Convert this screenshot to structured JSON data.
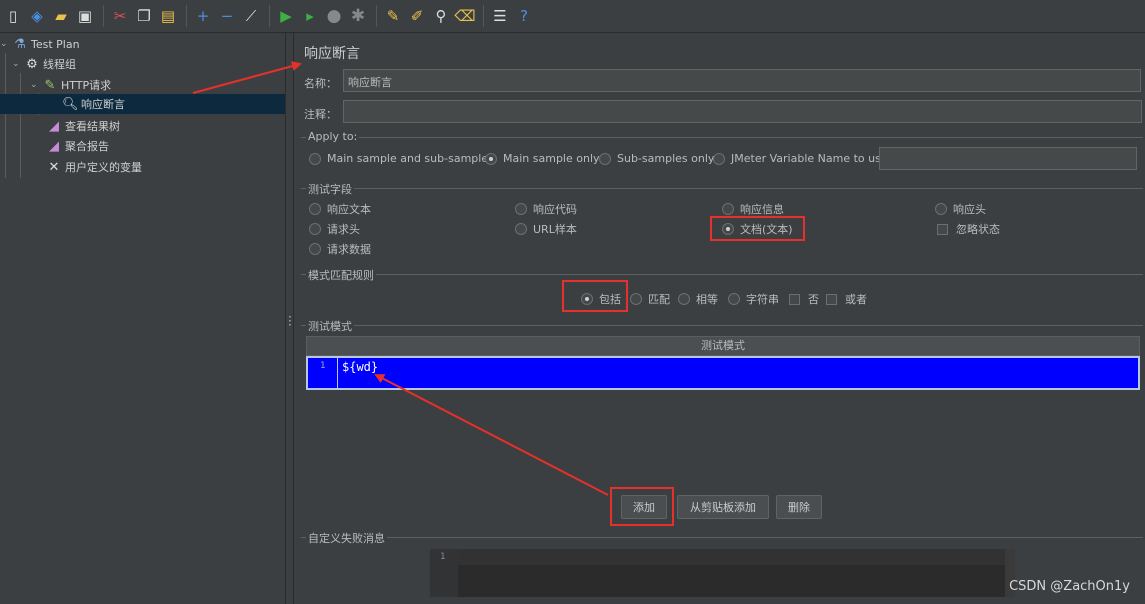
{
  "colors": {
    "accent_red": "#e5312a",
    "selection_blue": "#0000fe",
    "tree_selected": "#0d293e",
    "background": "#3c3f41"
  },
  "toolbar": {
    "icons": [
      "new-icon",
      "templates-icon",
      "open-icon",
      "save-icon",
      "cut-icon",
      "copy-icon",
      "paste-icon",
      "expand-icon",
      "collapse-icon",
      "toggle-icon",
      "start-icon",
      "start-no-pause-icon",
      "stop-icon",
      "shutdown-icon",
      "clear-icon",
      "clear-all-icon",
      "search-icon",
      "reset-search-icon",
      "function-helper-icon",
      "help-icon"
    ]
  },
  "tree": {
    "items": [
      {
        "label": "Test Plan",
        "icon": "flask-icon"
      },
      {
        "label": "线程组",
        "icon": "gear-icon"
      },
      {
        "label": "HTTP请求",
        "icon": "pipette-icon"
      },
      {
        "label": "响应断言",
        "icon": "assertion-icon"
      },
      {
        "label": "查看结果树",
        "icon": "chart-icon"
      },
      {
        "label": "聚合报告",
        "icon": "chart-icon"
      },
      {
        "label": "用户定义的变量",
        "icon": "tools-icon"
      }
    ]
  },
  "main": {
    "title": "响应断言",
    "name_label": "名称：",
    "name_value": "响应断言",
    "comment_label": "注释：",
    "comment_value": "",
    "apply_to": {
      "legend": "Apply to:",
      "options": [
        "Main sample and sub-samples",
        "Main sample only",
        "Sub-samples only",
        "JMeter Variable Name to use"
      ],
      "selected": "Main sample only",
      "variable_value": ""
    },
    "test_field": {
      "legend": "测试字段",
      "options": [
        "响应文本",
        "响应代码",
        "响应信息",
        "响应头",
        "请求头",
        "URL样本",
        "文档(文本)",
        "请求数据"
      ],
      "selected": "文档(文本)",
      "ignore_status": "忽略状态"
    },
    "pattern_rules": {
      "legend": "模式匹配规则",
      "radios": [
        "包括",
        "匹配",
        "相等",
        "字符串"
      ],
      "selected": "包括",
      "checks": [
        "否",
        "或者"
      ]
    },
    "test_patterns": {
      "legend": "测试模式",
      "column_header": "测试模式",
      "rows": [
        {
          "line": "1",
          "value": "${wd}"
        }
      ]
    },
    "buttons": {
      "add": "添加",
      "add_from_clipboard": "从剪贴板添加",
      "delete": "删除"
    },
    "custom_failure": {
      "legend": "自定义失败消息",
      "line": "1",
      "value": ""
    }
  },
  "watermark": "CSDN @ZachOn1y"
}
